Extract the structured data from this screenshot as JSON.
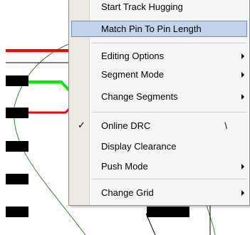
{
  "menu": {
    "items": [
      {
        "label": "Start Track Hugging"
      },
      {
        "label": "Match Pin To Pin Length"
      },
      {
        "label": "Editing Options"
      },
      {
        "label": "Segment Mode"
      },
      {
        "label": "Change Segments"
      },
      {
        "label": "Online DRC",
        "shortcut": "\\",
        "check": "✓"
      },
      {
        "label": "Display Clearance"
      },
      {
        "label": "Push Mode"
      },
      {
        "label": "Change Grid"
      }
    ]
  },
  "colors": {
    "trace_red": "#ff0000",
    "trace_green": "#00ee00",
    "pad_black": "#000000",
    "routing_line": "#00aa00"
  }
}
